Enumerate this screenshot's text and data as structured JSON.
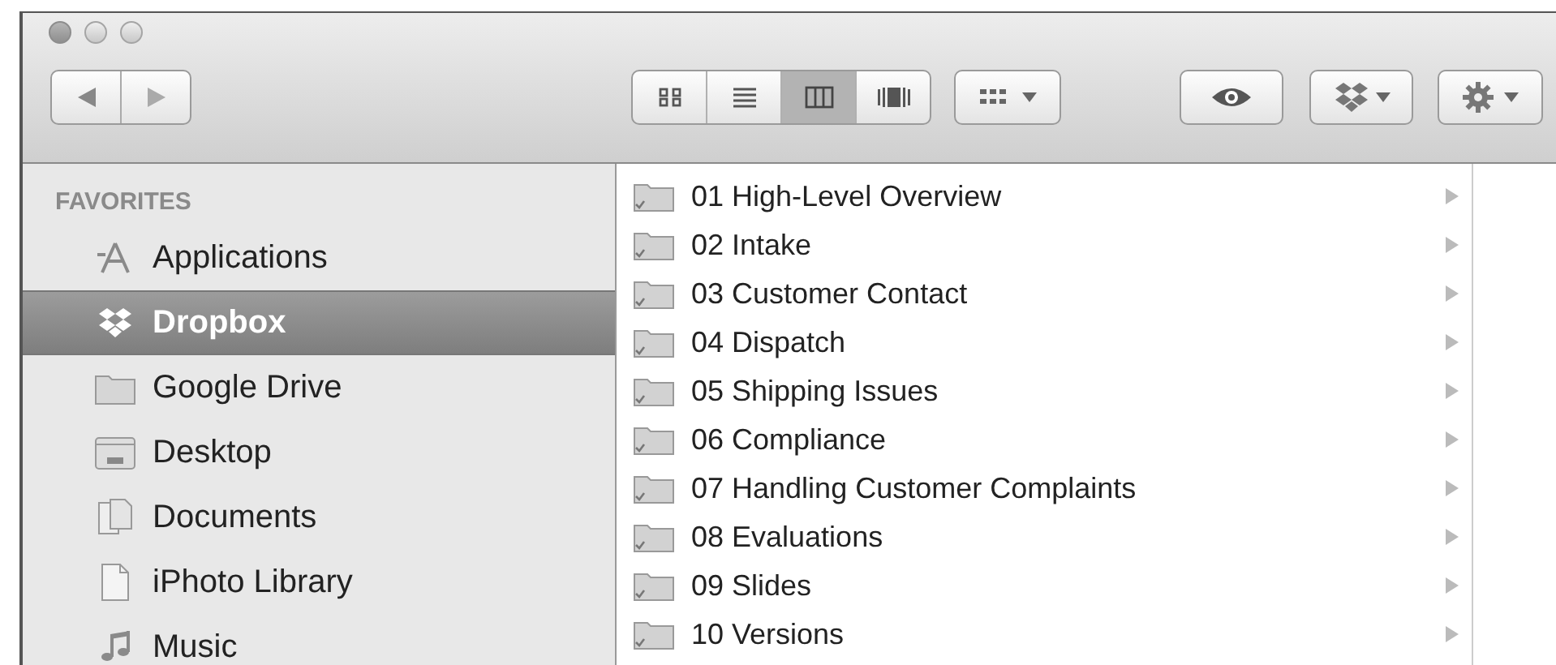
{
  "toolbar": {
    "view_buttons": [
      {
        "kind": "icons",
        "selected": false
      },
      {
        "kind": "list",
        "selected": false
      },
      {
        "kind": "columns",
        "selected": true
      },
      {
        "kind": "coverflow",
        "selected": false
      }
    ]
  },
  "sidebar": {
    "heading": "FAVORITES",
    "items": [
      {
        "label": "Applications",
        "kind": "applications",
        "selected": false
      },
      {
        "label": "Dropbox",
        "kind": "dropbox",
        "selected": true
      },
      {
        "label": "Google Drive",
        "kind": "folder",
        "selected": false
      },
      {
        "label": "Desktop",
        "kind": "desktop",
        "selected": false
      },
      {
        "label": "Documents",
        "kind": "documents",
        "selected": false
      },
      {
        "label": "iPhoto Library",
        "kind": "file",
        "selected": false
      },
      {
        "label": "Music",
        "kind": "music",
        "selected": false
      }
    ]
  },
  "column": {
    "items": [
      {
        "name": "01 High-Level Overview"
      },
      {
        "name": "02 Intake"
      },
      {
        "name": "03 Customer Contact"
      },
      {
        "name": "04 Dispatch"
      },
      {
        "name": "05 Shipping Issues"
      },
      {
        "name": "06 Compliance"
      },
      {
        "name": "07 Handling Customer Complaints"
      },
      {
        "name": "08 Evaluations"
      },
      {
        "name": "09 Slides"
      },
      {
        "name": "10 Versions"
      }
    ]
  }
}
